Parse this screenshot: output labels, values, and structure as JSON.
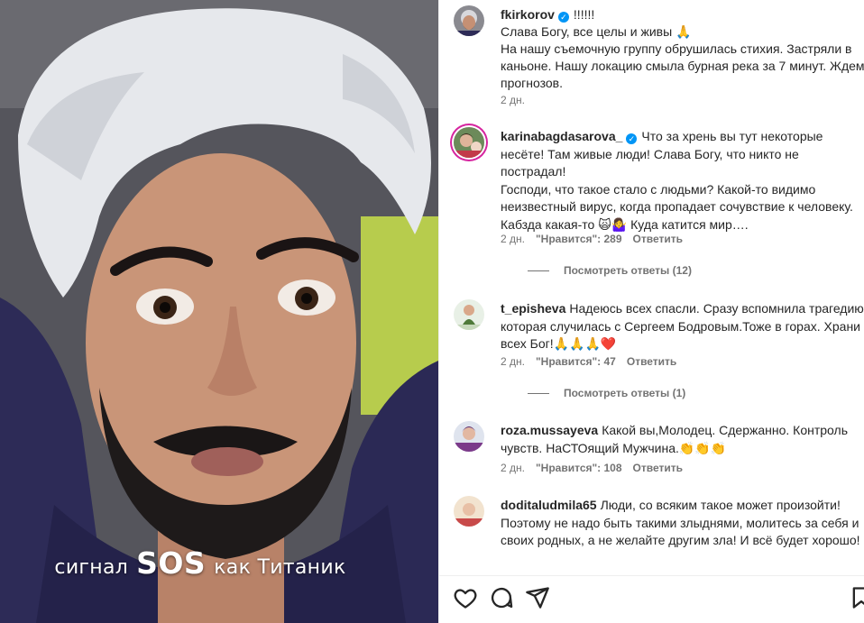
{
  "post": {
    "author": "fkirkorov",
    "caption_lines": [
      "!!!!!!",
      "Слава Богу, все целы и живы 🙏",
      "На нашу съемочную группу обрушилась стихия. Застряли в каньоне. Нашу локацию смыла бурная река за 7 минут. Ждем прогнозов."
    ],
    "time": "2 дн.",
    "overlay_text": {
      "before": "сигнал",
      "big": "SOS",
      "after": "как Титаник"
    }
  },
  "comments": [
    {
      "username": "karinabagdasarova_",
      "verified": true,
      "text": "Что за хрень вы тут некоторые несёте! Там живые люди! Слава Богу, что никто не пострадал!\nГосподи, что такое стало с людьми? Какой-то видимо неизвестный вирус, когда пропадает сочувствие к человеку. Кабзда какая-то 🙀🤷‍♀️ Куда катится мир….",
      "time": "2 дн.",
      "likes": "\"Нравится\": 289",
      "reply": "Ответить",
      "view_replies": "Посмотреть ответы (12)"
    },
    {
      "username": "t_episheva",
      "verified": false,
      "text": "Надеюсь всех спасли. Сразу вспомнила трагедию которая случилась с Сергеем Бодровым.Тоже в горах. Храни всех Бог!🙏🙏🙏❤️",
      "time": "2 дн.",
      "likes": "\"Нравится\": 47",
      "reply": "Ответить",
      "view_replies": "Посмотреть ответы (1)"
    },
    {
      "username": "roza.mussayeva",
      "verified": false,
      "text": "Какой вы,Молодец. Сдержанно. Контроль чувств. НаСТОящий Мужчина.👏👏👏",
      "time": "2 дн.",
      "likes": "\"Нравится\": 108",
      "reply": "Ответить"
    },
    {
      "username": "doditaludmila65",
      "verified": false,
      "text": "Люди, со всяким такое может произойти! Поэтому не надо быть такими злыднями, молитесь за себя и своих родных, а не желайте другим зла! И всё будет хорошо!"
    }
  ],
  "icons": {
    "like": "heart-icon",
    "comment": "comment-bubble-icon",
    "share": "paper-plane-icon",
    "save": "bookmark-icon"
  },
  "colors": {
    "verified": "#0095f6",
    "meta": "#737373",
    "heart": "#ed4956"
  }
}
